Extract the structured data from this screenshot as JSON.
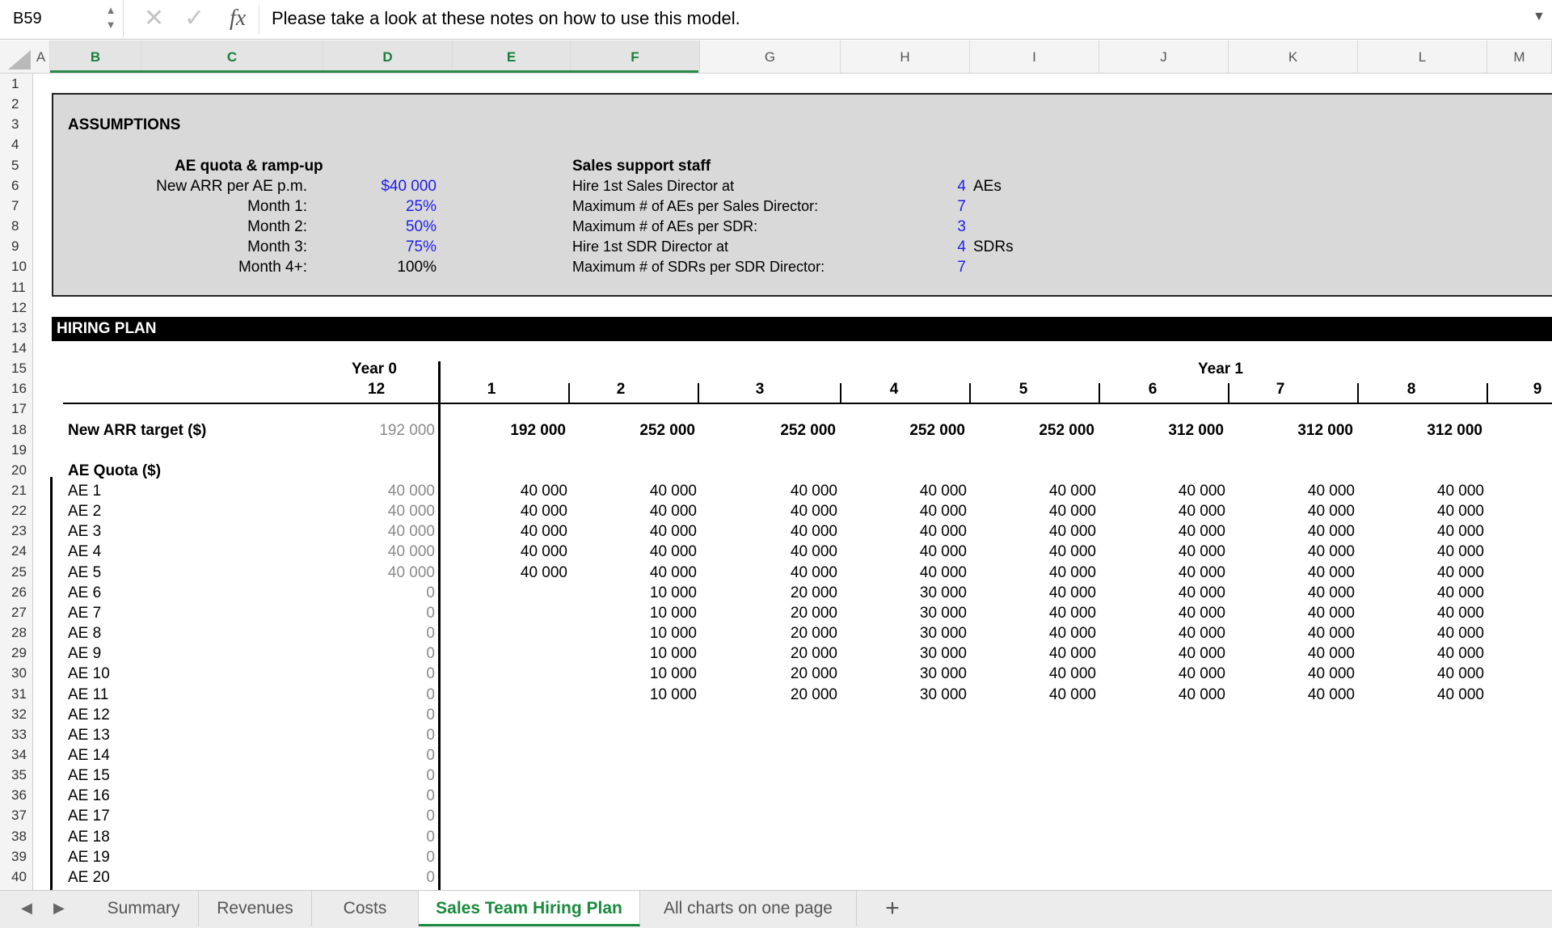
{
  "formula_bar": {
    "cell_ref": "B59",
    "fx": "fx",
    "formula": "Please take a look at these notes on how to use this model."
  },
  "columns": [
    {
      "label": "A",
      "selected": false
    },
    {
      "label": "B",
      "selected": true
    },
    {
      "label": "C",
      "selected": true
    },
    {
      "label": "D",
      "selected": true
    },
    {
      "label": "E",
      "selected": true
    },
    {
      "label": "F",
      "selected": true
    },
    {
      "label": "G",
      "selected": false
    },
    {
      "label": "H",
      "selected": false
    },
    {
      "label": "I",
      "selected": false
    },
    {
      "label": "J",
      "selected": false
    },
    {
      "label": "K",
      "selected": false
    },
    {
      "label": "L",
      "selected": false
    },
    {
      "label": "M",
      "selected": false
    }
  ],
  "rows": [
    "1",
    "2",
    "3",
    "4",
    "5",
    "6",
    "7",
    "8",
    "9",
    "10",
    "11",
    "12",
    "13",
    "14",
    "15",
    "16",
    "17",
    "18",
    "19",
    "20",
    "21",
    "22",
    "23",
    "24",
    "25",
    "26",
    "27",
    "28",
    "29",
    "30",
    "31",
    "32",
    "33",
    "34",
    "35",
    "36",
    "37",
    "38",
    "39",
    "40"
  ],
  "assumptions": {
    "title": "ASSUMPTIONS",
    "ae_section": {
      "heading": "AE quota & ramp-up",
      "rows": [
        {
          "label": "New ARR per AE p.m.",
          "value": "$40 000",
          "input": true
        },
        {
          "label": "Month 1:",
          "value": "25%",
          "input": true
        },
        {
          "label": "Month 2:",
          "value": "50%",
          "input": true
        },
        {
          "label": "Month 3:",
          "value": "75%",
          "input": true
        },
        {
          "label": "Month 4+:",
          "value": "100%",
          "input": false
        }
      ]
    },
    "support_section": {
      "heading": "Sales support staff",
      "rows": [
        {
          "label": "Hire 1st Sales Director at",
          "value": "4",
          "unit": "AEs"
        },
        {
          "label": "Maximum # of AEs per Sales Director:",
          "value": "7",
          "unit": ""
        },
        {
          "label": "Maximum # of AEs per SDR:",
          "value": "3",
          "unit": ""
        },
        {
          "label": "Hire 1st SDR Director at",
          "value": "4",
          "unit": "SDRs"
        },
        {
          "label": "Maximum # of SDRs per SDR Director:",
          "value": "7",
          "unit": ""
        }
      ]
    }
  },
  "hiring_plan": {
    "title": "HIRING PLAN",
    "year0_label": "Year 0",
    "year0_month": "12",
    "year1_label": "Year 1",
    "months": [
      "1",
      "2",
      "3",
      "4",
      "5",
      "6",
      "7",
      "8",
      "9"
    ],
    "arr_label": "New ARR target ($)",
    "arr_year0": "192 000",
    "arr_values": [
      "192 000",
      "252 000",
      "252 000",
      "252 000",
      "252 000",
      "312 000",
      "312 000",
      "312 000"
    ],
    "ae_quota_label": "AE Quota ($)",
    "ae_rows": [
      {
        "label": "AE 1",
        "y0": "40 000",
        "m": [
          "40 000",
          "40 000",
          "40 000",
          "40 000",
          "40 000",
          "40 000",
          "40 000",
          "40 000"
        ]
      },
      {
        "label": "AE 2",
        "y0": "40 000",
        "m": [
          "40 000",
          "40 000",
          "40 000",
          "40 000",
          "40 000",
          "40 000",
          "40 000",
          "40 000"
        ]
      },
      {
        "label": "AE 3",
        "y0": "40 000",
        "m": [
          "40 000",
          "40 000",
          "40 000",
          "40 000",
          "40 000",
          "40 000",
          "40 000",
          "40 000"
        ]
      },
      {
        "label": "AE 4",
        "y0": "40 000",
        "m": [
          "40 000",
          "40 000",
          "40 000",
          "40 000",
          "40 000",
          "40 000",
          "40 000",
          "40 000"
        ]
      },
      {
        "label": "AE 5",
        "y0": "40 000",
        "m": [
          "40 000",
          "40 000",
          "40 000",
          "40 000",
          "40 000",
          "40 000",
          "40 000",
          "40 000"
        ]
      },
      {
        "label": "AE 6",
        "y0": "0",
        "m": [
          "",
          "10 000",
          "20 000",
          "30 000",
          "40 000",
          "40 000",
          "40 000",
          "40 000"
        ]
      },
      {
        "label": "AE 7",
        "y0": "0",
        "m": [
          "",
          "10 000",
          "20 000",
          "30 000",
          "40 000",
          "40 000",
          "40 000",
          "40 000"
        ]
      },
      {
        "label": "AE 8",
        "y0": "0",
        "m": [
          "",
          "10 000",
          "20 000",
          "30 000",
          "40 000",
          "40 000",
          "40 000",
          "40 000"
        ]
      },
      {
        "label": "AE 9",
        "y0": "0",
        "m": [
          "",
          "10 000",
          "20 000",
          "30 000",
          "40 000",
          "40 000",
          "40 000",
          "40 000"
        ]
      },
      {
        "label": "AE 10",
        "y0": "0",
        "m": [
          "",
          "10 000",
          "20 000",
          "30 000",
          "40 000",
          "40 000",
          "40 000",
          "40 000"
        ]
      },
      {
        "label": "AE 11",
        "y0": "0",
        "m": [
          "",
          "10 000",
          "20 000",
          "30 000",
          "40 000",
          "40 000",
          "40 000",
          "40 000"
        ]
      },
      {
        "label": "AE 12",
        "y0": "0",
        "m": [
          "",
          "",
          "",
          "",
          "",
          "",
          "",
          ""
        ]
      },
      {
        "label": "AE 13",
        "y0": "0",
        "m": [
          "",
          "",
          "",
          "",
          "",
          "",
          "",
          ""
        ]
      },
      {
        "label": "AE 14",
        "y0": "0",
        "m": [
          "",
          "",
          "",
          "",
          "",
          "",
          "",
          ""
        ]
      },
      {
        "label": "AE 15",
        "y0": "0",
        "m": [
          "",
          "",
          "",
          "",
          "",
          "",
          "",
          ""
        ]
      },
      {
        "label": "AE 16",
        "y0": "0",
        "m": [
          "",
          "",
          "",
          "",
          "",
          "",
          "",
          ""
        ]
      },
      {
        "label": "AE 17",
        "y0": "0",
        "m": [
          "",
          "",
          "",
          "",
          "",
          "",
          "",
          ""
        ]
      },
      {
        "label": "AE 18",
        "y0": "0",
        "m": [
          "",
          "",
          "",
          "",
          "",
          "",
          "",
          ""
        ]
      },
      {
        "label": "AE 19",
        "y0": "0",
        "m": [
          "",
          "",
          "",
          "",
          "",
          "",
          "",
          ""
        ]
      },
      {
        "label": "AE 20",
        "y0": "0",
        "m": [
          "",
          "",
          "",
          "",
          "",
          "",
          "",
          ""
        ]
      }
    ]
  },
  "sheet_tabs": [
    {
      "label": "Summary",
      "active": false
    },
    {
      "label": "Revenues",
      "active": false
    },
    {
      "label": "Costs",
      "active": false
    },
    {
      "label": "Sales Team Hiring Plan",
      "active": true
    },
    {
      "label": "All charts on one page",
      "active": false
    }
  ],
  "add_sheet": "+",
  "colors": {
    "accent": "#1a8a3c",
    "input_blue": "#1e1ee6",
    "panel_grey": "#d9d9d9"
  }
}
